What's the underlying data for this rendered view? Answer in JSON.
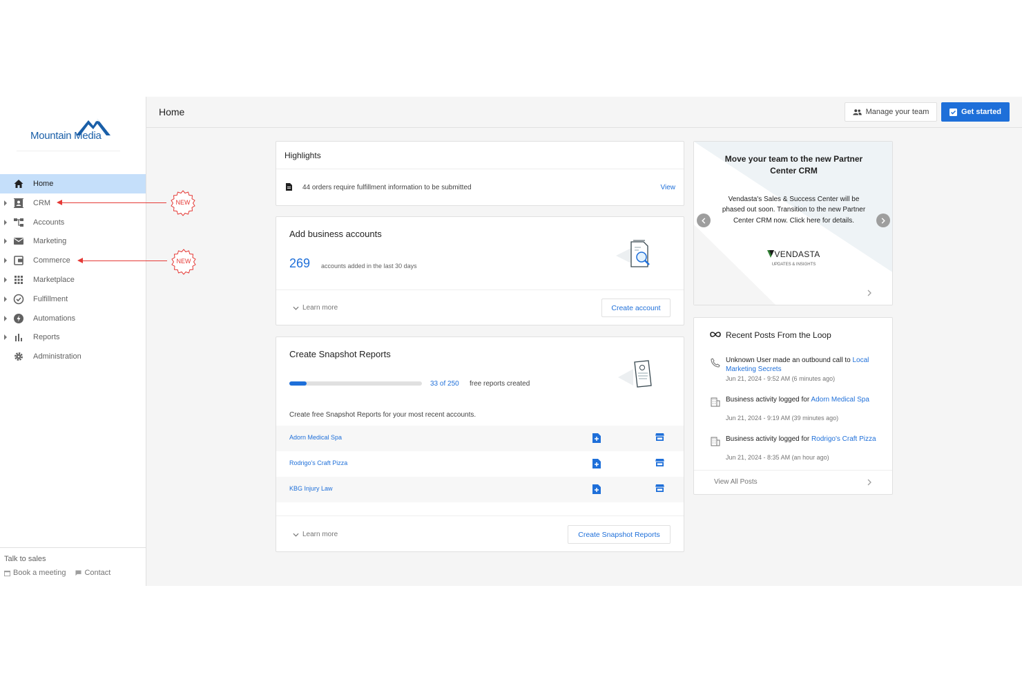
{
  "brand": {
    "logo_text": "Mountain Media",
    "logo_color": "#1a5fa8"
  },
  "colors": {
    "accent": "#1e6fd9",
    "active_nav_bg": "#c5dffa",
    "annotation_red": "#e53935"
  },
  "sidebar": {
    "items": [
      {
        "label": "Home",
        "icon": "home-icon",
        "active": true,
        "expandable": false
      },
      {
        "label": "CRM",
        "icon": "contacts-icon",
        "active": false,
        "expandable": true
      },
      {
        "label": "Accounts",
        "icon": "accounts-tree-icon",
        "active": false,
        "expandable": true
      },
      {
        "label": "Marketing",
        "icon": "mail-icon",
        "active": false,
        "expandable": true
      },
      {
        "label": "Commerce",
        "icon": "wallet-icon",
        "active": false,
        "expandable": true
      },
      {
        "label": "Marketplace",
        "icon": "grid-apps-icon",
        "active": false,
        "expandable": true
      },
      {
        "label": "Fulfillment",
        "icon": "check-circle-icon",
        "active": false,
        "expandable": true
      },
      {
        "label": "Automations",
        "icon": "bolt-circle-icon",
        "active": false,
        "expandable": true
      },
      {
        "label": "Reports",
        "icon": "bar-chart-icon",
        "active": false,
        "expandable": true
      },
      {
        "label": "Administration",
        "icon": "gear-icon",
        "active": false,
        "expandable": false
      }
    ],
    "footer": {
      "title": "Talk to sales",
      "book_meeting": "Book a meeting",
      "contact": "Contact"
    },
    "new_badges": [
      "NEW",
      "NEW"
    ]
  },
  "header": {
    "title": "Home",
    "manage_team": "Manage your team",
    "get_started": "Get started"
  },
  "highlights": {
    "title": "Highlights",
    "row_text": "44 orders require fulfillment information to be submitted",
    "row_action": "View"
  },
  "add_accounts": {
    "title": "Add business accounts",
    "count": "269",
    "count_sub": "accounts added in the last 30 days",
    "learn_more": "Learn more",
    "button": "Create account"
  },
  "snapshot": {
    "title": "Create Snapshot Reports",
    "progress_used": 33,
    "progress_total": 250,
    "progress_text": "33 of 250",
    "progress_sub": "free reports created",
    "description": "Create free Snapshot Reports for your most recent accounts.",
    "rows": [
      {
        "name": "Adorn Medical Spa"
      },
      {
        "name": "Rodrigo's Craft Pizza"
      },
      {
        "name": "KBG Injury Law"
      }
    ],
    "learn_more": "Learn more",
    "button": "Create Snapshot Reports"
  },
  "promo": {
    "title": "Move your team to the new Partner Center CRM",
    "body": "Vendasta's Sales & Success Center will be phased out soon. Transition to the new Partner Center CRM now. Click here for details.",
    "brand": "VENDASTA",
    "brand_sub": "UPDATES & INSIGHTS"
  },
  "loop": {
    "title": "Recent Posts From the Loop",
    "posts": [
      {
        "text": "Unknown User made an outbound call to ",
        "link": "Local Marketing Secrets",
        "date": "Jun 21, 2024 - 9:52 AM (6 minutes ago)",
        "icon": "phone-icon"
      },
      {
        "text": "Business activity logged for ",
        "link": "Adorn Medical Spa",
        "date": "Jun 21, 2024 - 9:19 AM (39 minutes ago)",
        "icon": "building-icon"
      },
      {
        "text": "Business activity logged for ",
        "link": "Rodrigo's Craft Pizza",
        "date": "Jun 21, 2024 - 8:35 AM (an hour ago)",
        "icon": "building-icon"
      }
    ],
    "view_all": "View All Posts"
  }
}
